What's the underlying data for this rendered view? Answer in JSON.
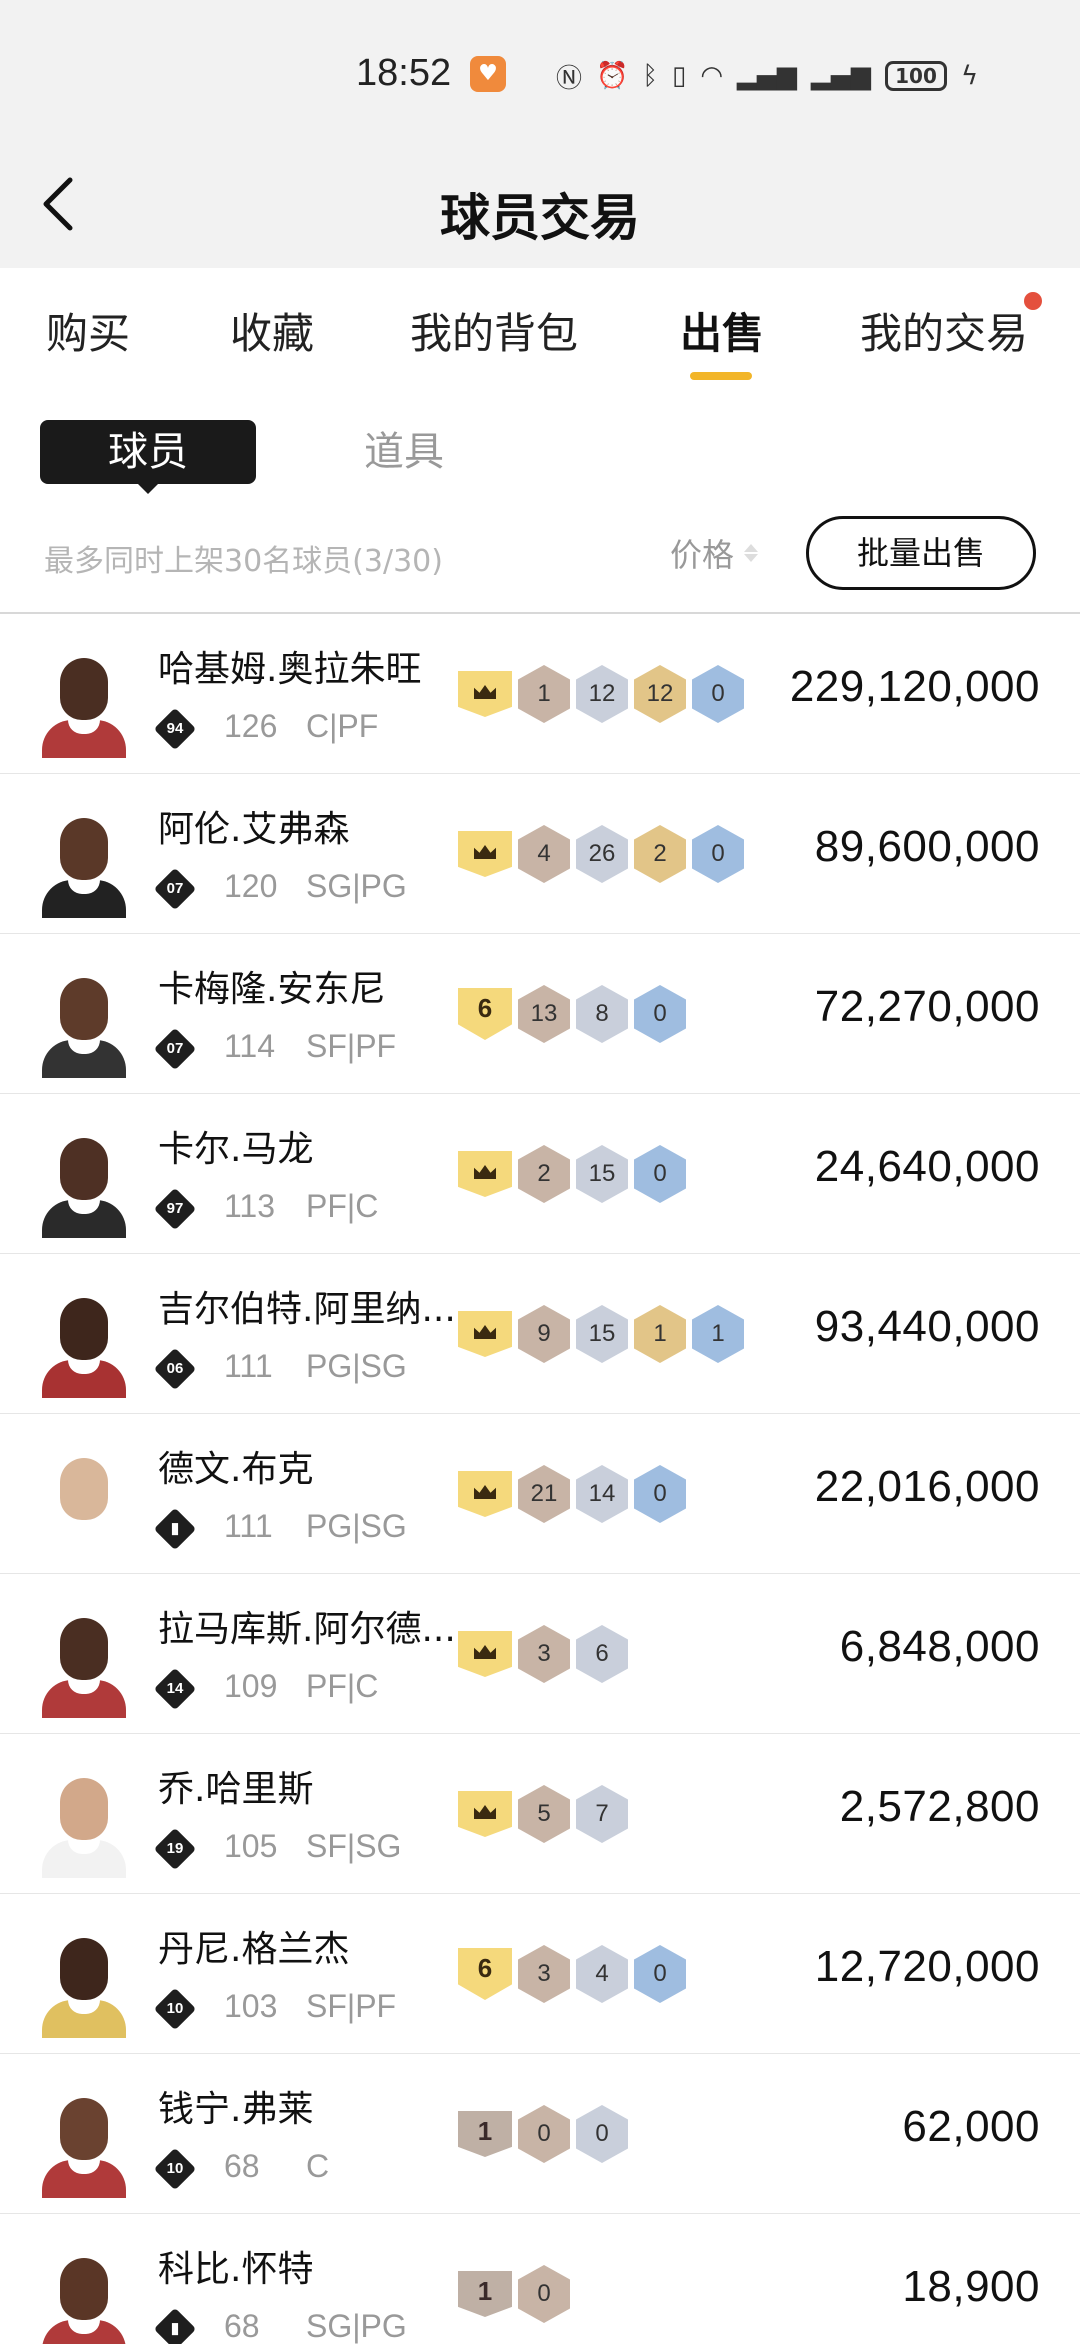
{
  "status": {
    "time": "18:52",
    "battery": "100"
  },
  "header": {
    "title": "球员交易"
  },
  "tabs": [
    {
      "label": "购买",
      "active": false
    },
    {
      "label": "收藏",
      "active": false
    },
    {
      "label": "我的背包",
      "active": false
    },
    {
      "label": "出售",
      "active": true
    },
    {
      "label": "我的交易",
      "active": false
    }
  ],
  "subtabs": {
    "players": "球员",
    "items": "道具"
  },
  "info": {
    "limit_text": "最多同时上架30名球员(3/30)",
    "price_sort": "价格",
    "bulk_sell": "批量出售"
  },
  "colors": {
    "accent": "#f2b528",
    "notify_dot": "#e4503d",
    "crown": "#f5d97c"
  },
  "players": [
    {
      "name": "哈基姆.奥拉朱旺",
      "tier": "94",
      "ovr": "126",
      "pos": "C|PF",
      "price": "229,120,000",
      "skin": "#4a2e22",
      "jersey": "#b03a3a",
      "badges": [
        {
          "t": "crown"
        },
        {
          "t": "hex",
          "c": "bronze",
          "v": "1"
        },
        {
          "t": "hex",
          "c": "silver",
          "v": "12"
        },
        {
          "t": "hex",
          "c": "gold",
          "v": "12"
        },
        {
          "t": "hex",
          "c": "blue",
          "v": "0"
        }
      ]
    },
    {
      "name": "阿伦.艾弗森",
      "tier": "07",
      "ovr": "120",
      "pos": "SG|PG",
      "price": "89,600,000",
      "skin": "#5a3828",
      "jersey": "#222222",
      "badges": [
        {
          "t": "crown"
        },
        {
          "t": "hex",
          "c": "bronze",
          "v": "4"
        },
        {
          "t": "hex",
          "c": "silver",
          "v": "26"
        },
        {
          "t": "hex",
          "c": "gold",
          "v": "2"
        },
        {
          "t": "hex",
          "c": "blue",
          "v": "0"
        }
      ]
    },
    {
      "name": "卡梅隆.安东尼",
      "tier": "07",
      "ovr": "114",
      "pos": "SF|PF",
      "price": "72,270,000",
      "skin": "#5e3b2a",
      "jersey": "#333333",
      "badges": [
        {
          "t": "level",
          "v": "6"
        },
        {
          "t": "hex",
          "c": "bronze",
          "v": "13"
        },
        {
          "t": "hex",
          "c": "silver",
          "v": "8"
        },
        {
          "t": "hex",
          "c": "blue",
          "v": "0"
        }
      ]
    },
    {
      "name": "卡尔.马龙",
      "tier": "97",
      "ovr": "113",
      "pos": "PF|C",
      "price": "24,640,000",
      "skin": "#4e3024",
      "jersey": "#2a2a2a",
      "badges": [
        {
          "t": "crown"
        },
        {
          "t": "hex",
          "c": "bronze",
          "v": "2"
        },
        {
          "t": "hex",
          "c": "silver",
          "v": "15"
        },
        {
          "t": "hex",
          "c": "blue",
          "v": "0"
        }
      ]
    },
    {
      "name": "吉尔伯特.阿里纳...",
      "tier": "06",
      "ovr": "111",
      "pos": "PG|SG",
      "price": "93,440,000",
      "skin": "#3e261c",
      "jersey": "#a83232",
      "badges": [
        {
          "t": "crown"
        },
        {
          "t": "hex",
          "c": "bronze",
          "v": "9"
        },
        {
          "t": "hex",
          "c": "silver",
          "v": "15"
        },
        {
          "t": "hex",
          "c": "gold",
          "v": "1"
        },
        {
          "t": "hex",
          "c": "blue",
          "v": "1"
        }
      ]
    },
    {
      "name": "德文.布克",
      "tier": "bars",
      "ovr": "111",
      "pos": "PG|SG",
      "price": "22,016,000",
      "skin": "#d9b79a",
      "jersey": "#ffffff",
      "badges": [
        {
          "t": "crown"
        },
        {
          "t": "hex",
          "c": "bronze",
          "v": "21"
        },
        {
          "t": "hex",
          "c": "silver",
          "v": "14"
        },
        {
          "t": "hex",
          "c": "blue",
          "v": "0"
        }
      ]
    },
    {
      "name": "拉马库斯.阿尔德...",
      "tier": "14",
      "ovr": "109",
      "pos": "PF|C",
      "price": "6,848,000",
      "skin": "#4a2e22",
      "jersey": "#b03a3a",
      "badges": [
        {
          "t": "crown"
        },
        {
          "t": "hex",
          "c": "bronze",
          "v": "3"
        },
        {
          "t": "hex",
          "c": "silver",
          "v": "6"
        }
      ]
    },
    {
      "name": "乔.哈里斯",
      "tier": "19",
      "ovr": "105",
      "pos": "SF|SG",
      "price": "2,572,800",
      "skin": "#d2a88a",
      "jersey": "#f2f2f2",
      "badges": [
        {
          "t": "crown"
        },
        {
          "t": "hex",
          "c": "bronze",
          "v": "5"
        },
        {
          "t": "hex",
          "c": "silver",
          "v": "7"
        }
      ]
    },
    {
      "name": "丹尼.格兰杰",
      "tier": "10",
      "ovr": "103",
      "pos": "SF|PF",
      "price": "12,720,000",
      "skin": "#3e261c",
      "jersey": "#e0c060",
      "badges": [
        {
          "t": "level",
          "v": "6"
        },
        {
          "t": "hex",
          "c": "bronze",
          "v": "3"
        },
        {
          "t": "hex",
          "c": "silver",
          "v": "4"
        },
        {
          "t": "hex",
          "c": "blue",
          "v": "0"
        }
      ]
    },
    {
      "name": "钱宁.弗莱",
      "tier": "10",
      "ovr": "68",
      "pos": "C",
      "price": "62,000",
      "skin": "#6a4230",
      "jersey": "#b03a3a",
      "badges": [
        {
          "t": "rank1",
          "v": "1"
        },
        {
          "t": "hex",
          "c": "bronze",
          "v": "0"
        },
        {
          "t": "hex",
          "c": "silver",
          "v": "0"
        }
      ]
    },
    {
      "name": "科比.怀特",
      "tier": "bars",
      "ovr": "68",
      "pos": "SG|PG",
      "price": "18,900",
      "skin": "#5a3626",
      "jersey": "#b03a3a",
      "badges": [
        {
          "t": "rank1",
          "v": "1"
        },
        {
          "t": "hex",
          "c": "bronze",
          "v": "0"
        }
      ]
    }
  ]
}
